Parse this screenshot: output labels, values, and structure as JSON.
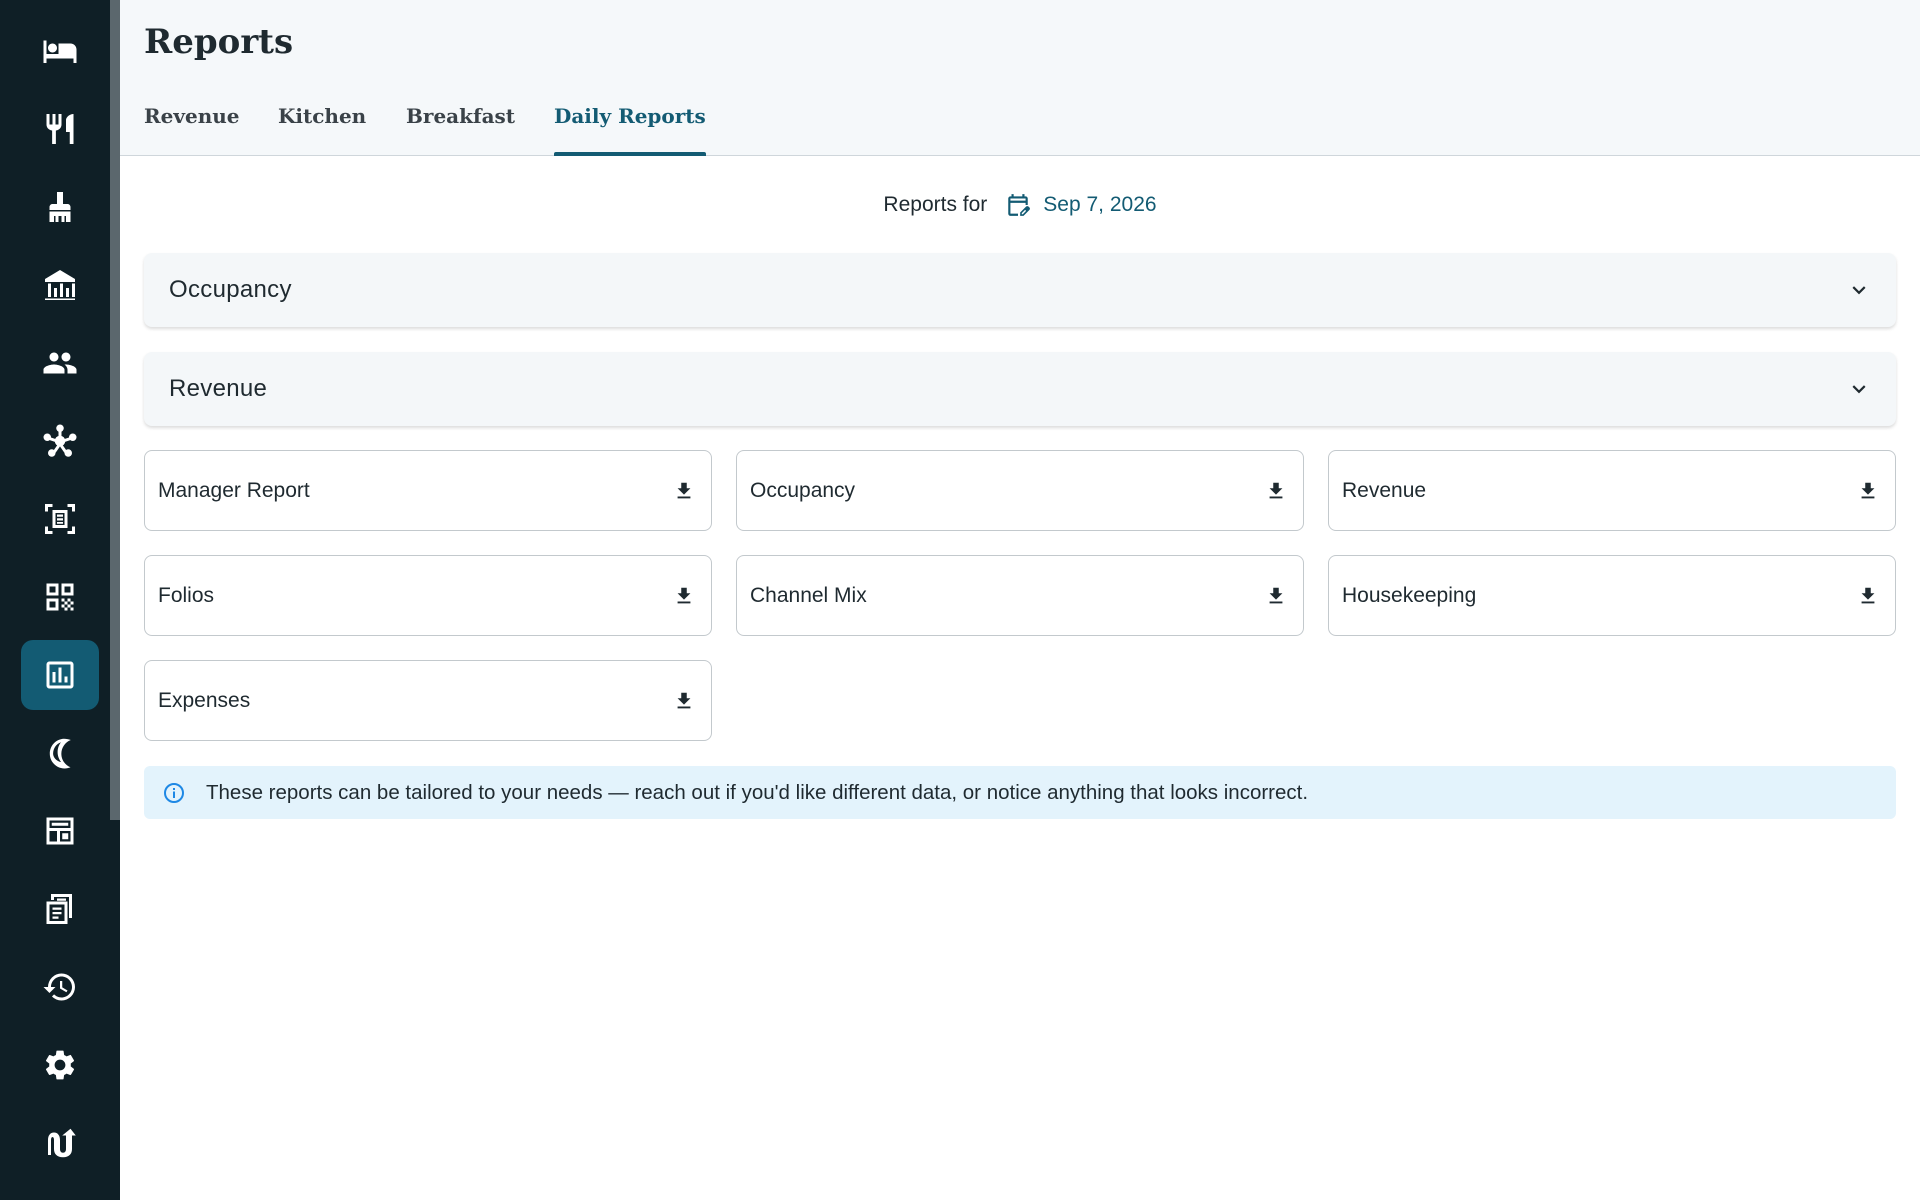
{
  "sidebar": {
    "items": [
      {
        "icon": "bed-icon",
        "label": "Rooms",
        "active": false
      },
      {
        "icon": "utensils-icon",
        "label": "Restaurant",
        "active": false
      },
      {
        "icon": "broom-icon",
        "label": "Housekeeping",
        "active": false
      },
      {
        "icon": "building-icon",
        "label": "Property",
        "active": false
      },
      {
        "icon": "people-icon",
        "label": "Guests",
        "active": false
      },
      {
        "icon": "hub-icon",
        "label": "Channels",
        "active": false
      },
      {
        "icon": "receipt-scan-icon",
        "label": "Invoices",
        "active": false
      },
      {
        "icon": "qr-code-icon",
        "label": "QR Codes",
        "active": false
      },
      {
        "icon": "report-chart-icon",
        "label": "Reports",
        "active": true
      },
      {
        "icon": "moon-icon",
        "label": "Night Audit",
        "active": false
      },
      {
        "icon": "layout-icon",
        "label": "Layout",
        "active": false
      },
      {
        "icon": "document-list-icon",
        "label": "Documents",
        "active": false
      },
      {
        "icon": "history-icon",
        "label": "History",
        "active": false
      },
      {
        "icon": "gear-icon",
        "label": "Settings",
        "active": false
      },
      {
        "icon": "logout-icon",
        "label": "Switch",
        "active": false
      }
    ]
  },
  "header": {
    "title": "Reports",
    "tabs": [
      {
        "label": "Revenue",
        "active": false
      },
      {
        "label": "Kitchen",
        "active": false
      },
      {
        "label": "Breakfast",
        "active": false
      },
      {
        "label": "Daily Reports",
        "active": true
      }
    ]
  },
  "date_row": {
    "label": "Reports for",
    "date": "Sep 7, 2026",
    "icon": "calendar-edit-icon"
  },
  "accordions": [
    {
      "title": "Occupancy",
      "icon": "chevron-down-icon"
    },
    {
      "title": "Revenue",
      "icon": "chevron-down-icon"
    }
  ],
  "reports": [
    {
      "label": "Manager Report",
      "icon": "download-icon"
    },
    {
      "label": "Occupancy",
      "icon": "download-icon"
    },
    {
      "label": "Revenue",
      "icon": "download-icon"
    },
    {
      "label": "Folios",
      "icon": "download-icon"
    },
    {
      "label": "Channel Mix",
      "icon": "download-icon"
    },
    {
      "label": "Housekeeping",
      "icon": "download-icon"
    },
    {
      "label": "Expenses",
      "icon": "download-icon"
    }
  ],
  "info": {
    "icon": "info-icon",
    "text": "These reports can be tailored to your needs — reach out if you'd like different data, or notice anything that looks incorrect."
  },
  "colors": {
    "sidebar_bg": "#0f1f26",
    "accent": "#135b73",
    "info_bg": "#e3f3fc",
    "info_icon": "#1e88e5"
  }
}
